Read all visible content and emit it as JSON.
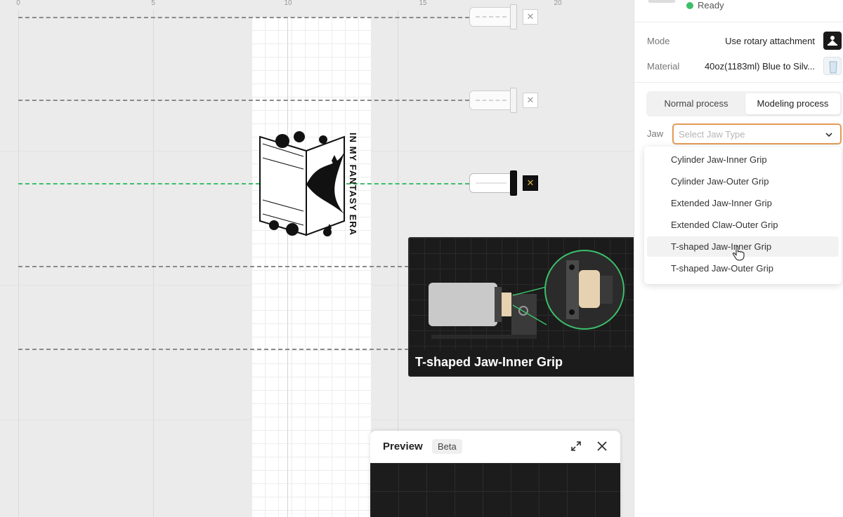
{
  "ruler": {
    "ticks": [
      "0",
      "5",
      "10",
      "15",
      "20"
    ]
  },
  "design": {
    "text": "IN MY FANTASY ERA"
  },
  "tooltip": {
    "caption": "T-shaped Jaw-Inner Grip"
  },
  "preview": {
    "title": "Preview",
    "badge": "Beta"
  },
  "panel": {
    "status": "Ready",
    "mode_label": "Mode",
    "mode_value": "Use rotary attachment",
    "material_label": "Material",
    "material_value": "40oz(1183ml) Blue to Silv...",
    "tabs": [
      {
        "label": "Normal process",
        "active": false
      },
      {
        "label": "Modeling process",
        "active": true
      }
    ],
    "jaw_label": "Jaw",
    "jaw_placeholder": "Select Jaw Type",
    "jaw_options": [
      "Cylinder Jaw-Inner Grip",
      "Cylinder Jaw-Outer Grip",
      "Extended Jaw-Inner Grip",
      "Extended Claw-Outer Grip",
      "T-shaped Jaw-Inner Grip",
      "T-shaped Jaw-Outer Grip"
    ],
    "hovered_option": "T-shaped Jaw-Inner Grip"
  },
  "colors": {
    "active_line": "#3bbf6a",
    "select_border": "#e29a56",
    "status": "#3bbf6a"
  }
}
